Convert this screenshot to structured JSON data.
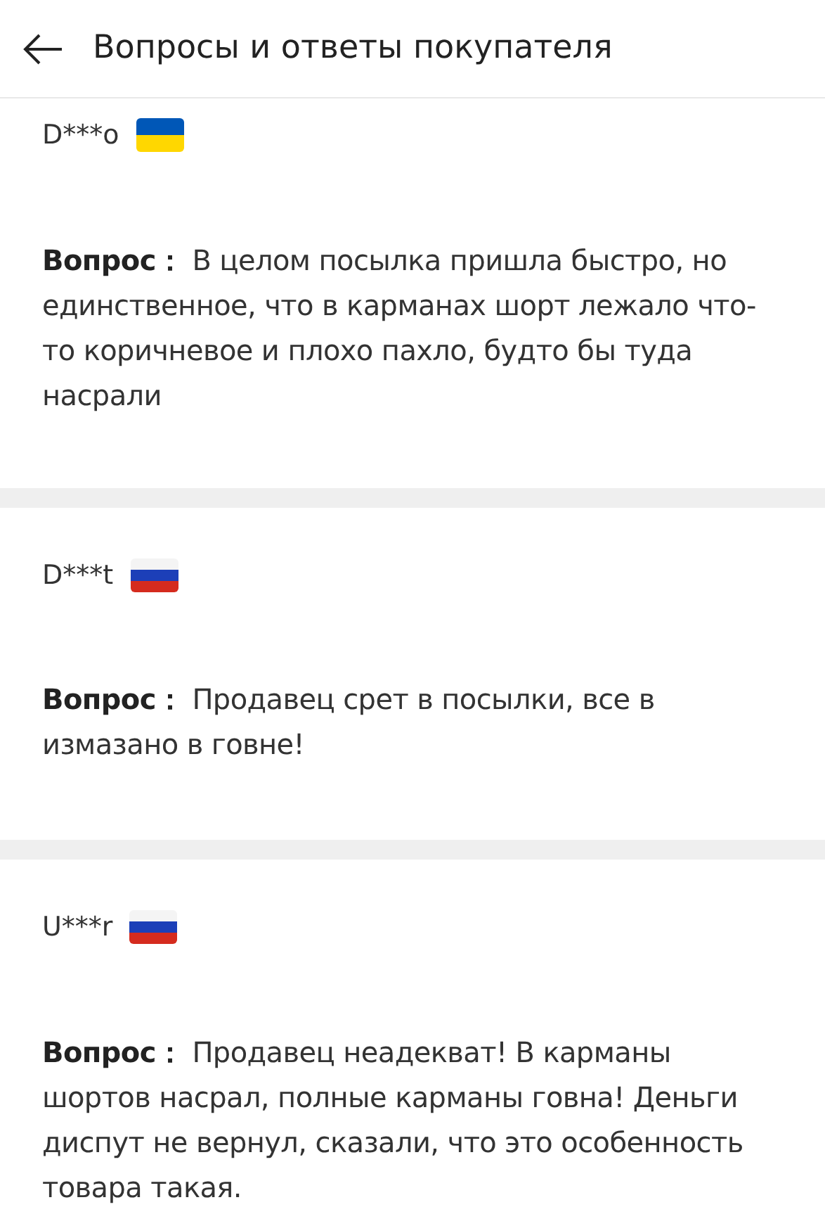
{
  "header": {
    "title": "Вопросы и ответы покупателя"
  },
  "questions": [
    {
      "user": "D***o",
      "kind": "ua",
      "label": "Вопрос：",
      "text": "В целом посылка пришла быстро, но единственное, что в карманах шорт лежало что-то коричневое и плохо пахло, будто бы туда насрали"
    },
    {
      "user": "D***t",
      "kind": "ru",
      "label": "Вопрос：",
      "text": "Продавец срет в посылки, все в измазано в говне!"
    },
    {
      "user": "U***r",
      "kind": "ru",
      "label": "Вопрос：",
      "text": "Продавец неадекват! В карманы шортов насрал, полные карманы говна! Деньги диспут не вернул, сказали, что это особенность товара такая."
    }
  ]
}
